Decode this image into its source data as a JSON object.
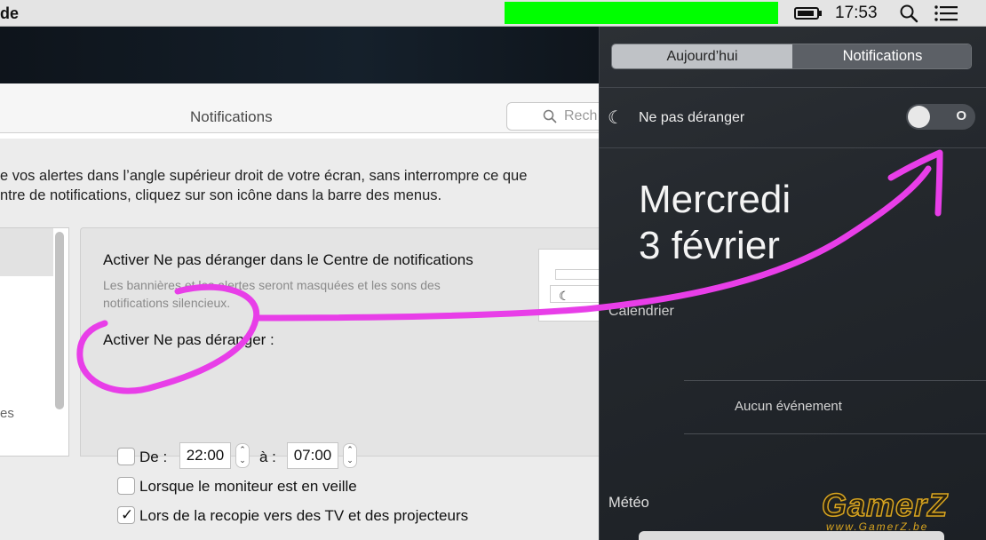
{
  "menubar": {
    "app_label": "de",
    "time": "17:53"
  },
  "prefs": {
    "title": "Notifications",
    "search_placeholder": "Rech",
    "desc_line1": "e vos alertes dans l’angle supérieur droit de votre écran, sans interrompre ce que",
    "desc_line2": "ntre de notifications, cliquez sur son icône dans la barre des menus.",
    "left_partial_text": "es",
    "activate_nc_label": "Activer Ne pas déranger dans le Centre de notifications",
    "activate_nc_sub1": "Les bannières et les alertes seront masquées et les sons des",
    "activate_nc_sub2": "notifications silencieux.",
    "activate_label": "Activer Ne pas déranger :",
    "from_label": "De :",
    "from_time": "22:00",
    "to_label": "à :",
    "to_time": "07:00",
    "sleep_label": "Lorsque le moniteur est en veille",
    "mirror_label": "Lors de la recopie vers des TV et des projecteurs",
    "from_checked": false,
    "sleep_checked": false,
    "mirror_checked": true
  },
  "nc": {
    "tab_today": "Aujourd’hui",
    "tab_notifications": "Notifications",
    "dnd_label": "Ne pas déranger",
    "dnd_toggle_text": "O",
    "dnd_on": false,
    "day": "Mercredi",
    "date": "3 février",
    "calendar_title": "Calendrier",
    "no_event": "Aucun événement",
    "weather_title": "Météo"
  },
  "watermark": {
    "text": "GamerZ",
    "sub": "www.GamerZ.be"
  },
  "colors": {
    "annotation": "#e83ee8",
    "highlight": "#00ff00"
  }
}
